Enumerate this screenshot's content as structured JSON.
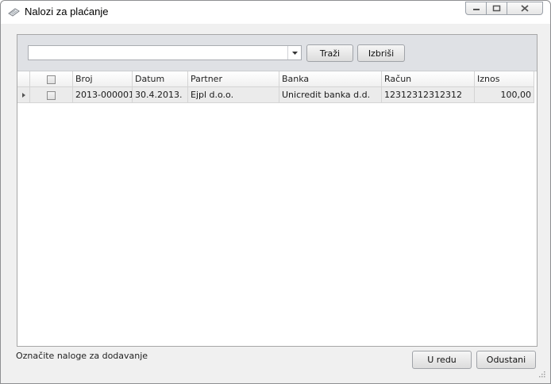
{
  "window": {
    "title": "Nalozi za plaćanje",
    "icon": "money-check-icon"
  },
  "filter": {
    "search_value": "",
    "search_button": "Traži",
    "clear_button": "Izbriši"
  },
  "grid": {
    "columns": [
      "Broj",
      "Datum",
      "Partner",
      "Banka",
      "Račun",
      "Iznos"
    ],
    "rows": [
      {
        "selected": false,
        "values": [
          "2013-000001",
          "30.4.2013.",
          "Ejpl d.o.o.",
          "Unicredit banka d.d.",
          "12312312312312",
          "100,00"
        ]
      }
    ]
  },
  "footer": {
    "status_text": "Označite naloge za dodavanje",
    "ok_button": "U redu",
    "cancel_button": "Odustani"
  }
}
